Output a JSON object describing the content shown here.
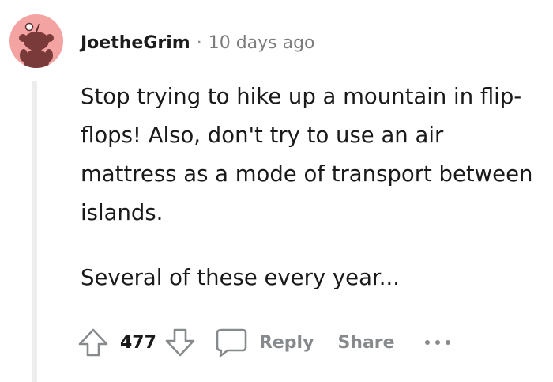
{
  "comment": {
    "author": "JoetheGrim",
    "separator": "·",
    "timestamp": "10 days ago",
    "paragraphs": [
      "Stop trying to hike up a mountain in flip-flops! Also, don't try to use an air mattress as a mode of transport between islands.",
      "Several of these every year..."
    ],
    "avatar_icon": "snoo-avatar-icon",
    "avatar_color": "#f4a3a3"
  },
  "actions": {
    "upvote_icon": "upvote-arrow-icon",
    "vote_count": "477",
    "downvote_icon": "downvote-arrow-icon",
    "reply_icon": "speech-bubble-icon",
    "reply_label": "Reply",
    "share_label": "Share",
    "more_icon": "more-options-icon",
    "more_label": "•••"
  },
  "colors": {
    "text": "#1a1a1b",
    "muted": "#878a8c",
    "thread_line": "#ededed"
  }
}
